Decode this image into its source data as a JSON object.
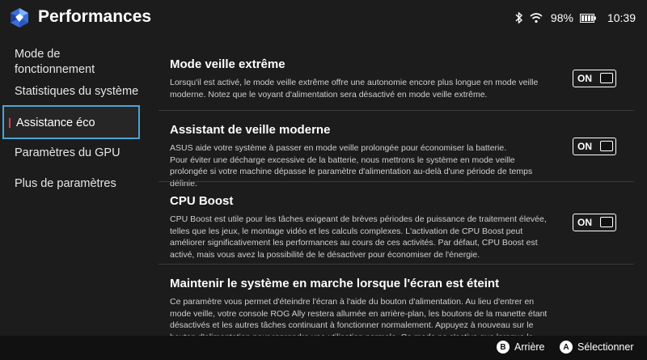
{
  "header": {
    "title": "Performances",
    "battery_percent": "98%",
    "time": "10:39"
  },
  "sidebar": {
    "items": [
      {
        "label": "Mode de fonctionnement",
        "active": false
      },
      {
        "label": "Statistiques du système",
        "active": false
      },
      {
        "label": "Assistance éco",
        "active": true
      },
      {
        "label": "Paramètres du GPU",
        "active": false
      },
      {
        "label": "Plus de paramètres",
        "active": false
      }
    ]
  },
  "sections": [
    {
      "title": "Mode veille extrême",
      "desc": "Lorsqu'il est activé, le mode veille extrême offre une autonomie encore plus longue en mode veille moderne. Notez que le voyant d'alimentation sera désactivé en mode veille extrême.",
      "toggle": "ON"
    },
    {
      "title": "Assistant de veille moderne",
      "desc_lines": [
        "ASUS aide votre système à passer en mode veille prolongée pour économiser la batterie.",
        "Pour éviter une décharge excessive de la batterie, nous mettrons le système en mode veille prolongée si votre machine dépasse le paramètre d'alimentation au-delà d'une période de temps définie."
      ],
      "toggle": "ON"
    },
    {
      "title": "CPU Boost",
      "desc": "CPU Boost est utile pour les tâches exigeant de brèves périodes de puissance de traitement élevée, telles que les jeux, le montage vidéo et les calculs complexes. L'activation de CPU Boost peut améliorer significativement les performances au cours de ces activités. Par défaut, CPU Boost est activé, mais vous avez la possibilité de le désactiver pour économiser de l'énergie.",
      "toggle": "ON"
    },
    {
      "title": "Maintenir le système en marche lorsque l'écran est éteint",
      "desc": "Ce paramètre vous permet d'éteindre l'écran à l'aide du bouton d'alimentation. Au lieu d'entrer en mode veille, votre console ROG Ally restera allumée en arrière-plan, les boutons de la manette étant désactivés et les autres tâches continuant à fonctionner normalement. Appuyez à nouveau sur le bouton d'alimentation pour reprendre une utilisation normale. Ce mode ne s'active que lorsque la console ROG Ally sera"
    }
  ],
  "footer": {
    "back_key": "B",
    "back_label": "Arrière",
    "select_key": "A",
    "select_label": "Sélectionner"
  },
  "colors": {
    "background": "#1c1c1c",
    "accent_focus": "#4aa3d6",
    "active_marker": "#e8384f"
  }
}
